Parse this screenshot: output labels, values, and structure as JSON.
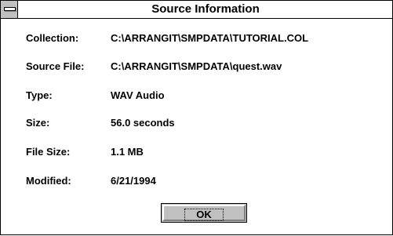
{
  "window": {
    "title": "Source Information"
  },
  "fields": [
    {
      "label": "Collection:",
      "value": "C:\\ARRANGIT\\SMPDATA\\TUTORIAL.COL"
    },
    {
      "label": "Source File:",
      "value": "C:\\ARRANGIT\\SMPDATA\\quest.wav"
    },
    {
      "label": "Type:",
      "value": "WAV Audio"
    },
    {
      "label": "Size:",
      "value": "56.0 seconds"
    },
    {
      "label": "File Size:",
      "value": "1.1 MB"
    },
    {
      "label": "Modified:",
      "value": "6/21/1994"
    }
  ],
  "buttons": {
    "ok_label": "OK"
  },
  "icons": {
    "system_menu": "system-menu-icon"
  },
  "colors": {
    "window_bg": "#ffffff",
    "button_face": "#c0c0c0",
    "text": "#000000"
  }
}
